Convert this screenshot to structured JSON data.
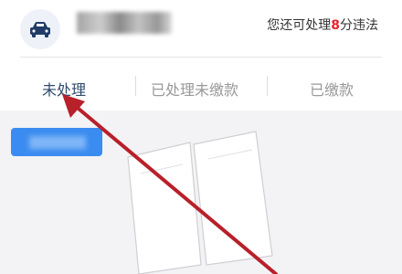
{
  "header": {
    "avatar_icon": "car-icon",
    "violation_note": {
      "prefix": "您还可处理",
      "points": "8",
      "suffix": "分违法"
    }
  },
  "tabs": [
    {
      "label": "未处理",
      "active": true
    },
    {
      "label": "已处理未缴款",
      "active": false
    },
    {
      "label": "已缴款",
      "active": false
    }
  ],
  "colors": {
    "accent_blue": "#3b8cf0",
    "points_red": "#e8232c",
    "annotation_arrow": "#b8202a",
    "active_tab": "#2f4a6d"
  },
  "annotation": {
    "type": "arrow",
    "target": "tab-unprocessed"
  }
}
